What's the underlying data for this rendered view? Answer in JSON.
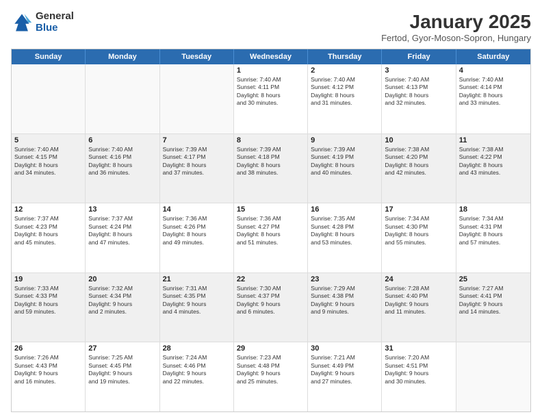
{
  "header": {
    "logo_general": "General",
    "logo_blue": "Blue",
    "month_year": "January 2025",
    "location": "Fertod, Gyor-Moson-Sopron, Hungary"
  },
  "days_of_week": [
    "Sunday",
    "Monday",
    "Tuesday",
    "Wednesday",
    "Thursday",
    "Friday",
    "Saturday"
  ],
  "weeks": [
    [
      {
        "day": "",
        "info": "",
        "empty": true
      },
      {
        "day": "",
        "info": "",
        "empty": true
      },
      {
        "day": "",
        "info": "",
        "empty": true
      },
      {
        "day": "1",
        "info": "Sunrise: 7:40 AM\nSunset: 4:11 PM\nDaylight: 8 hours\nand 30 minutes.",
        "shaded": false
      },
      {
        "day": "2",
        "info": "Sunrise: 7:40 AM\nSunset: 4:12 PM\nDaylight: 8 hours\nand 31 minutes.",
        "shaded": false
      },
      {
        "day": "3",
        "info": "Sunrise: 7:40 AM\nSunset: 4:13 PM\nDaylight: 8 hours\nand 32 minutes.",
        "shaded": false
      },
      {
        "day": "4",
        "info": "Sunrise: 7:40 AM\nSunset: 4:14 PM\nDaylight: 8 hours\nand 33 minutes.",
        "shaded": false
      }
    ],
    [
      {
        "day": "5",
        "info": "Sunrise: 7:40 AM\nSunset: 4:15 PM\nDaylight: 8 hours\nand 34 minutes.",
        "shaded": true
      },
      {
        "day": "6",
        "info": "Sunrise: 7:40 AM\nSunset: 4:16 PM\nDaylight: 8 hours\nand 36 minutes.",
        "shaded": true
      },
      {
        "day": "7",
        "info": "Sunrise: 7:39 AM\nSunset: 4:17 PM\nDaylight: 8 hours\nand 37 minutes.",
        "shaded": true
      },
      {
        "day": "8",
        "info": "Sunrise: 7:39 AM\nSunset: 4:18 PM\nDaylight: 8 hours\nand 38 minutes.",
        "shaded": true
      },
      {
        "day": "9",
        "info": "Sunrise: 7:39 AM\nSunset: 4:19 PM\nDaylight: 8 hours\nand 40 minutes.",
        "shaded": true
      },
      {
        "day": "10",
        "info": "Sunrise: 7:38 AM\nSunset: 4:20 PM\nDaylight: 8 hours\nand 42 minutes.",
        "shaded": true
      },
      {
        "day": "11",
        "info": "Sunrise: 7:38 AM\nSunset: 4:22 PM\nDaylight: 8 hours\nand 43 minutes.",
        "shaded": true
      }
    ],
    [
      {
        "day": "12",
        "info": "Sunrise: 7:37 AM\nSunset: 4:23 PM\nDaylight: 8 hours\nand 45 minutes.",
        "shaded": false
      },
      {
        "day": "13",
        "info": "Sunrise: 7:37 AM\nSunset: 4:24 PM\nDaylight: 8 hours\nand 47 minutes.",
        "shaded": false
      },
      {
        "day": "14",
        "info": "Sunrise: 7:36 AM\nSunset: 4:26 PM\nDaylight: 8 hours\nand 49 minutes.",
        "shaded": false
      },
      {
        "day": "15",
        "info": "Sunrise: 7:36 AM\nSunset: 4:27 PM\nDaylight: 8 hours\nand 51 minutes.",
        "shaded": false
      },
      {
        "day": "16",
        "info": "Sunrise: 7:35 AM\nSunset: 4:28 PM\nDaylight: 8 hours\nand 53 minutes.",
        "shaded": false
      },
      {
        "day": "17",
        "info": "Sunrise: 7:34 AM\nSunset: 4:30 PM\nDaylight: 8 hours\nand 55 minutes.",
        "shaded": false
      },
      {
        "day": "18",
        "info": "Sunrise: 7:34 AM\nSunset: 4:31 PM\nDaylight: 8 hours\nand 57 minutes.",
        "shaded": false
      }
    ],
    [
      {
        "day": "19",
        "info": "Sunrise: 7:33 AM\nSunset: 4:33 PM\nDaylight: 8 hours\nand 59 minutes.",
        "shaded": true
      },
      {
        "day": "20",
        "info": "Sunrise: 7:32 AM\nSunset: 4:34 PM\nDaylight: 9 hours\nand 2 minutes.",
        "shaded": true
      },
      {
        "day": "21",
        "info": "Sunrise: 7:31 AM\nSunset: 4:35 PM\nDaylight: 9 hours\nand 4 minutes.",
        "shaded": true
      },
      {
        "day": "22",
        "info": "Sunrise: 7:30 AM\nSunset: 4:37 PM\nDaylight: 9 hours\nand 6 minutes.",
        "shaded": true
      },
      {
        "day": "23",
        "info": "Sunrise: 7:29 AM\nSunset: 4:38 PM\nDaylight: 9 hours\nand 9 minutes.",
        "shaded": true
      },
      {
        "day": "24",
        "info": "Sunrise: 7:28 AM\nSunset: 4:40 PM\nDaylight: 9 hours\nand 11 minutes.",
        "shaded": true
      },
      {
        "day": "25",
        "info": "Sunrise: 7:27 AM\nSunset: 4:41 PM\nDaylight: 9 hours\nand 14 minutes.",
        "shaded": true
      }
    ],
    [
      {
        "day": "26",
        "info": "Sunrise: 7:26 AM\nSunset: 4:43 PM\nDaylight: 9 hours\nand 16 minutes.",
        "shaded": false
      },
      {
        "day": "27",
        "info": "Sunrise: 7:25 AM\nSunset: 4:45 PM\nDaylight: 9 hours\nand 19 minutes.",
        "shaded": false
      },
      {
        "day": "28",
        "info": "Sunrise: 7:24 AM\nSunset: 4:46 PM\nDaylight: 9 hours\nand 22 minutes.",
        "shaded": false
      },
      {
        "day": "29",
        "info": "Sunrise: 7:23 AM\nSunset: 4:48 PM\nDaylight: 9 hours\nand 25 minutes.",
        "shaded": false
      },
      {
        "day": "30",
        "info": "Sunrise: 7:21 AM\nSunset: 4:49 PM\nDaylight: 9 hours\nand 27 minutes.",
        "shaded": false
      },
      {
        "day": "31",
        "info": "Sunrise: 7:20 AM\nSunset: 4:51 PM\nDaylight: 9 hours\nand 30 minutes.",
        "shaded": false
      },
      {
        "day": "",
        "info": "",
        "empty": true
      }
    ]
  ]
}
